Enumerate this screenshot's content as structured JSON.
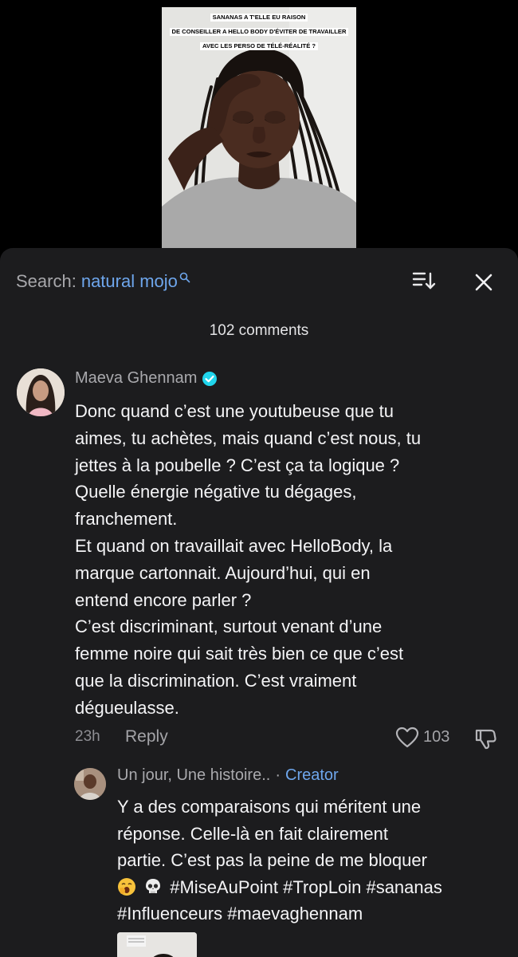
{
  "video": {
    "caption_lines": [
      "SANANAS A T'ELLE EU RAISON",
      "DE CONSEILLER A HELLO BODY D'ÉVITER DE TRAVAILLER",
      "AVEC LES PERSO DE TÉLÉ-RÉALITÉ ?"
    ]
  },
  "header": {
    "search_prefix": "Search:",
    "search_term": "natural mojo",
    "sort_icon": "sort-icon",
    "close_icon": "close-icon"
  },
  "comment_count": "102 comments",
  "comment": {
    "author": "Maeva Ghennam",
    "verified": true,
    "lines": [
      "Donc quand c’est une youtubeuse que tu",
      "aimes, tu achètes, mais quand c’est nous, tu",
      "jettes à la poubelle ? C’est ça ta logique ?",
      "Quelle énergie négative tu dégages,",
      "franchement.",
      "Et quand on travaillait avec HelloBody, la",
      "marque cartonnait. Aujourd’hui, qui en",
      "entend encore parler ?",
      "C’est discriminant, surtout venant d’une",
      "femme noire qui sait très bien ce que c’est",
      "que la discrimination. C’est vraiment",
      "dégueulasse."
    ],
    "time": "23h",
    "reply_label": "Reply",
    "likes": "103"
  },
  "reply": {
    "author": "Un jour, Une histoire..",
    "separator": "·",
    "badge": "Creator",
    "lines": [
      "Y a des comparaisons qui méritent une",
      "réponse. Celle-là en fait clairement",
      "partie. C’est pas la peine de me bloquer"
    ],
    "emoji_line_text": "#MiseAuPoint #TropLoin #sananas",
    "last_line": "#Influenceurs #maevaghennam",
    "emojis": [
      "yawning-face-emoji",
      "skull-emoji"
    ]
  },
  "colors": {
    "sheet_bg": "#1c1c1e",
    "accent_blue": "#6ea6ec",
    "verified_blue": "#20d5ec",
    "text_primary": "#f4f4f6",
    "text_secondary": "#a9a9ad"
  }
}
